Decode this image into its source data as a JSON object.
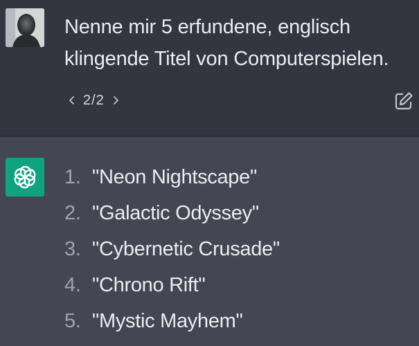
{
  "user_message": {
    "avatar_icon": "user-avatar-photo",
    "text": "Nenne mir 5 erfundene, englisch klingende Titel von Computerspielen.",
    "pager": {
      "prev_icon": "chevron-left-icon",
      "label": "2/2",
      "next_icon": "chevron-right-icon"
    },
    "edit_icon": "edit-icon"
  },
  "assistant_message": {
    "avatar_icon": "openai-logo-icon",
    "items": [
      {
        "num": "1.",
        "title": "\"Neon Nightscape\""
      },
      {
        "num": "2.",
        "title": "\"Galactic Odyssey\""
      },
      {
        "num": "3.",
        "title": "\"Cybernetic Crusade\""
      },
      {
        "num": "4.",
        "title": "\"Chrono Rift\""
      },
      {
        "num": "5.",
        "title": "\"Mystic Mayhem\""
      }
    ]
  },
  "colors": {
    "user_bg": "#343541",
    "assistant_bg": "#444654",
    "text": "#ececf1",
    "muted": "#a3a3b0",
    "brand": "#10a37f"
  }
}
